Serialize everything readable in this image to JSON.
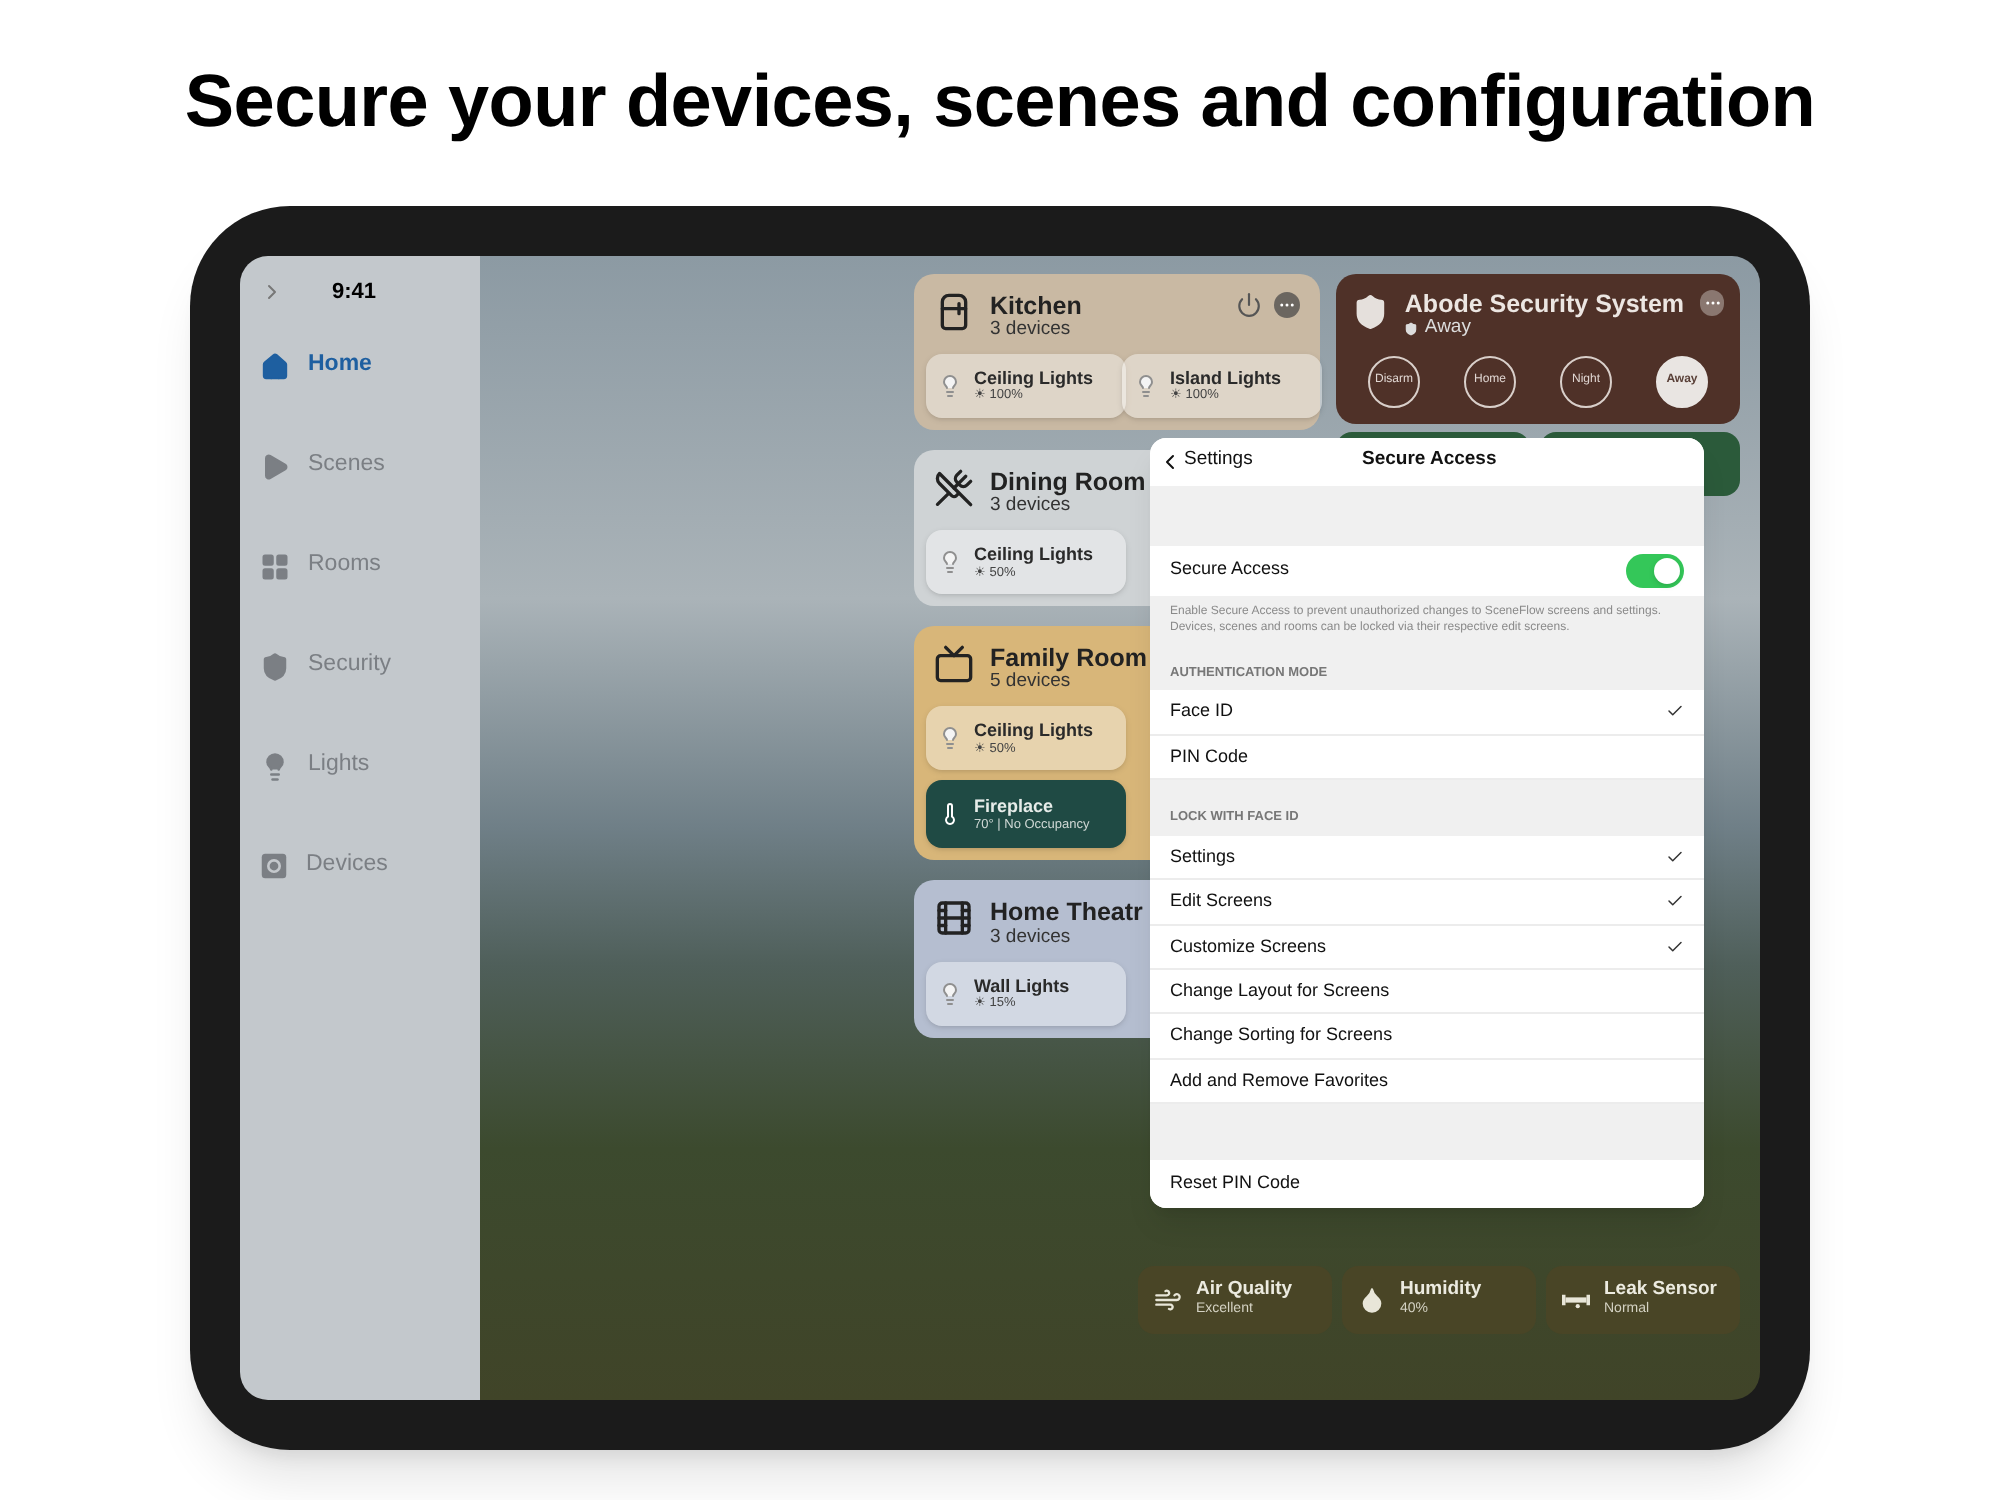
{
  "headline": "Secure your devices, scenes and configuration",
  "sidebar": {
    "time": "9:41",
    "items": [
      {
        "label": "Home",
        "kind": "home",
        "selected": true
      },
      {
        "label": "Scenes",
        "kind": "scenes",
        "selected": false
      },
      {
        "label": "Rooms",
        "kind": "rooms",
        "selected": false
      },
      {
        "label": "Security",
        "kind": "security",
        "selected": false
      },
      {
        "label": "Lights",
        "kind": "lights",
        "selected": false
      },
      {
        "label": "Devices",
        "kind": "devices",
        "selected": false
      }
    ]
  },
  "rooms": [
    {
      "name": "Kitchen",
      "subtitle": "3 devices",
      "kind": "kitchen",
      "color": "#c9b9a3",
      "header_buttons": true,
      "devices": [
        {
          "kind": "light",
          "name": "Ceiling Lights",
          "reading": "☀ 100%"
        },
        {
          "kind": "light",
          "name": "Island Lights",
          "reading": "☀ 100%"
        }
      ]
    },
    {
      "name": "Dining Room",
      "subtitle": "3 devices",
      "kind": "dining",
      "color": "#cfd3d5",
      "devices": [
        {
          "kind": "light",
          "name": "Ceiling Lights",
          "reading": "☀ 50%"
        }
      ]
    },
    {
      "name": "Family Room",
      "subtitle": "5 devices",
      "kind": "tv",
      "color": "#d8b679",
      "devices": [
        {
          "kind": "light",
          "name": "Ceiling Lights",
          "reading": "☀ 50%"
        },
        {
          "kind": "thermostat",
          "name": "Fireplace",
          "reading": "70°  |  No Occupancy"
        }
      ]
    },
    {
      "name": "Home Theatr",
      "subtitle": "3 devices",
      "kind": "film",
      "color": "#b5bed0",
      "devices": [
        {
          "kind": "light",
          "name": "Wall Lights",
          "reading": "☀ 15%"
        }
      ]
    }
  ],
  "security": {
    "name": "Abode Security System",
    "status": "Away",
    "modes": [
      {
        "label": "Disarm",
        "selected": false
      },
      {
        "label": "Home",
        "selected": false
      },
      {
        "label": "Night",
        "selected": false
      },
      {
        "label": "Away",
        "selected": true
      }
    ]
  },
  "sensors": [
    {
      "kind": "air",
      "name": "Air Quality",
      "reading": "Excellent"
    },
    {
      "kind": "humidity",
      "name": "Humidity",
      "reading": "40%"
    },
    {
      "kind": "leak",
      "name": "Leak Sensor",
      "reading": "Normal"
    }
  ],
  "settings_sheet": {
    "back": "Settings",
    "title": "Secure Access",
    "secure_access": {
      "label": "Secure Access",
      "on": true
    },
    "description": "Enable Secure Access to prevent unauthorized changes to SceneFlow screens and settings. Devices, scenes and rooms can be locked via their respective edit screens.",
    "sections": [
      {
        "header": "AUTHENTICATION MODE",
        "rows": [
          {
            "label": "Face ID",
            "checked": true
          },
          {
            "label": "PIN Code",
            "checked": false
          }
        ]
      },
      {
        "header": "LOCK WITH FACE ID",
        "rows": [
          {
            "label": "Settings",
            "checked": true
          },
          {
            "label": "Edit Screens",
            "checked": true
          },
          {
            "label": "Customize Screens",
            "checked": true
          },
          {
            "label": "Change Layout for Screens",
            "checked": false
          },
          {
            "label": "Change Sorting for Screens",
            "checked": false
          },
          {
            "label": "Add and Remove Favorites",
            "checked": false
          }
        ]
      }
    ],
    "reset": "Reset PIN Code"
  }
}
